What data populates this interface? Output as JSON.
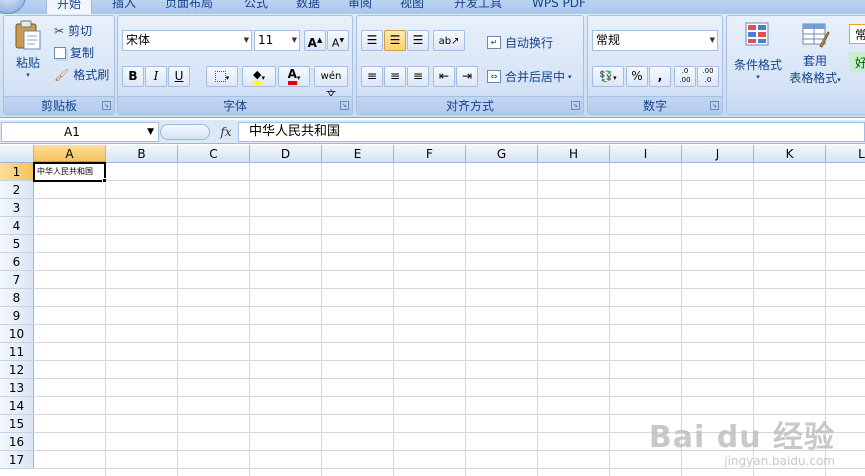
{
  "tabs": [
    {
      "label": "开始",
      "active": true
    },
    {
      "label": "插入",
      "active": false
    },
    {
      "label": "页面布局",
      "active": false
    },
    {
      "label": "公式",
      "active": false
    },
    {
      "label": "数据",
      "active": false
    },
    {
      "label": "审阅",
      "active": false
    },
    {
      "label": "视图",
      "active": false
    },
    {
      "label": "开发工具",
      "active": false
    },
    {
      "label": "WPS PDF",
      "active": false
    }
  ],
  "clipboard": {
    "group_label": "剪贴板",
    "paste": "粘贴",
    "cut": "剪切",
    "copy": "复制",
    "format_painter": "格式刷"
  },
  "font": {
    "group_label": "字体",
    "font_name": "宋体",
    "font_size": "11",
    "grow": "A",
    "shrink": "A",
    "bold": "B",
    "italic": "I",
    "underline": "U",
    "font_color_glyph": "A",
    "phonetic": "wén 文",
    "fill_color": "#ffff00",
    "text_color": "#e00000"
  },
  "alignment": {
    "group_label": "对齐方式",
    "wrap_text": "自动换行",
    "merge_center": "合并后居中"
  },
  "number": {
    "group_label": "数字",
    "format": "常规",
    "percent": "%",
    "comma": ",",
    "inc_decimal": ".0 .00",
    "dec_decimal": ".00 .0"
  },
  "styles": {
    "conditional_format": "条件格式",
    "table_format_line1": "套用",
    "table_format_line2": "表格格式",
    "style_normal": "常",
    "style_good": "好"
  },
  "formula_bar": {
    "name_box": "A1",
    "fx": "fx",
    "content": "中华人民共和国"
  },
  "grid": {
    "columns": [
      "A",
      "B",
      "C",
      "D",
      "E",
      "F",
      "G",
      "H",
      "I",
      "J",
      "K",
      "L"
    ],
    "rows": [
      "1",
      "2",
      "3",
      "4",
      "5",
      "6",
      "7",
      "8",
      "9",
      "10",
      "11",
      "12",
      "13",
      "14",
      "15",
      "16",
      "17"
    ],
    "active_cell_value": "中华人民共和国"
  },
  "watermark": {
    "main": "Bai du 经验",
    "sub": "jingyan.baidu.com"
  },
  "colors": {
    "accent": "#15428b",
    "selected_header": "#f7c25c",
    "gridline": "#d0d7e5"
  }
}
